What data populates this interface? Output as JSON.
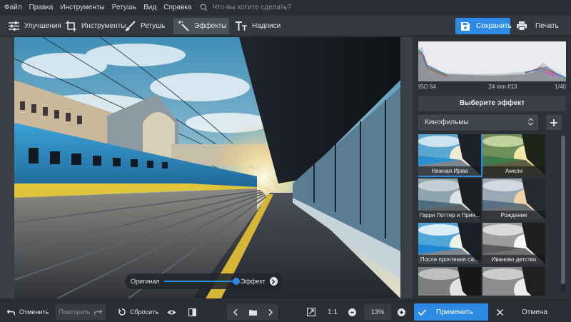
{
  "menu": {
    "items": [
      "Файл",
      "Правка",
      "Инструменты",
      "Ретушь",
      "Вид",
      "Справка"
    ],
    "search_placeholder": "Что вы хотите сделать?"
  },
  "toolbar": {
    "tabs": [
      {
        "label": "Улучшения",
        "icon": "sliders-icon"
      },
      {
        "label": "Инструменты",
        "icon": "crop-icon"
      },
      {
        "label": "Ретушь",
        "icon": "brush-icon"
      },
      {
        "label": "Эффекты",
        "icon": "magic-wand-icon"
      },
      {
        "label": "Надписи",
        "icon": "text-icon"
      }
    ],
    "active_tab": "Эффекты",
    "save_label": "Сохранить",
    "print_label": "Печать"
  },
  "canvas": {
    "compare_left": "Оригинал",
    "compare_right": "Эффект",
    "compare_value": 1.0
  },
  "histogram": {
    "iso": "ISO 64",
    "lens": "24 mm f/13",
    "shutter": "1/40"
  },
  "effects": {
    "title": "Выберите эффект",
    "category": "Кинофильмы",
    "items": [
      {
        "label": "Нежная Ирма",
        "selected": true
      },
      {
        "label": "Амели",
        "selected": false
      },
      {
        "label": "Гарри Поттер и Прин...",
        "selected": false
      },
      {
        "label": "Рождение",
        "selected": false
      },
      {
        "label": "После прочтения сж...",
        "selected": false
      },
      {
        "label": "Иваново детство",
        "selected": false
      },
      {
        "label": "",
        "selected": false
      },
      {
        "label": "",
        "selected": false
      }
    ]
  },
  "bottombar": {
    "undo_label": "Отменить",
    "redo_label": "Повторить",
    "reset_label": "Сбросить",
    "ratio_label": "1:1",
    "zoom_value": "13%",
    "apply_label": "Применить",
    "cancel_label": "Отмена"
  },
  "colors": {
    "accent": "#2d8be6",
    "background": "#2b2f35",
    "panel": "#2e3238"
  }
}
